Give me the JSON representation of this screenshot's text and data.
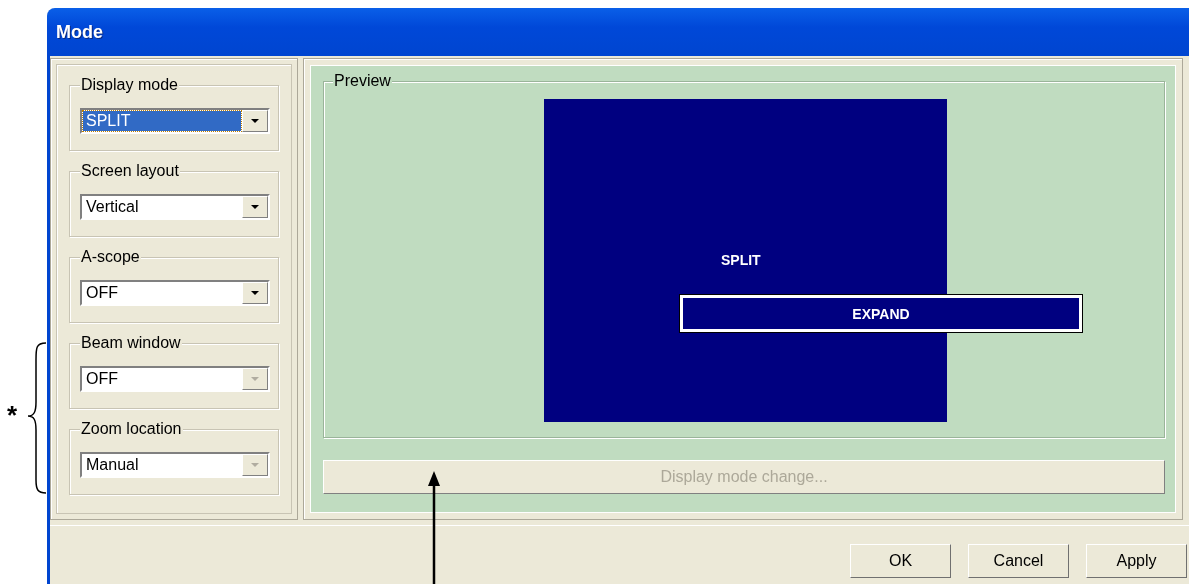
{
  "window": {
    "title": "Mode"
  },
  "settings": [
    {
      "label": "Display mode",
      "value": "SPLIT",
      "focused": true,
      "disabled": false
    },
    {
      "label": "Screen layout",
      "value": "Vertical",
      "focused": false,
      "disabled": false
    },
    {
      "label": "A-scope",
      "value": "OFF",
      "focused": false,
      "disabled": false
    },
    {
      "label": "Beam window",
      "value": "OFF",
      "focused": false,
      "disabled": true
    },
    {
      "label": "Zoom location",
      "value": "Manual",
      "focused": false,
      "disabled": true
    }
  ],
  "preview": {
    "title": "Preview",
    "screen_label": "SPLIT",
    "expand_label": "EXPAND"
  },
  "change_button": {
    "label": "Display mode change...",
    "disabled": true
  },
  "buttons": [
    "OK",
    "Cancel",
    "Apply"
  ],
  "annotation": {
    "mark": "*"
  }
}
